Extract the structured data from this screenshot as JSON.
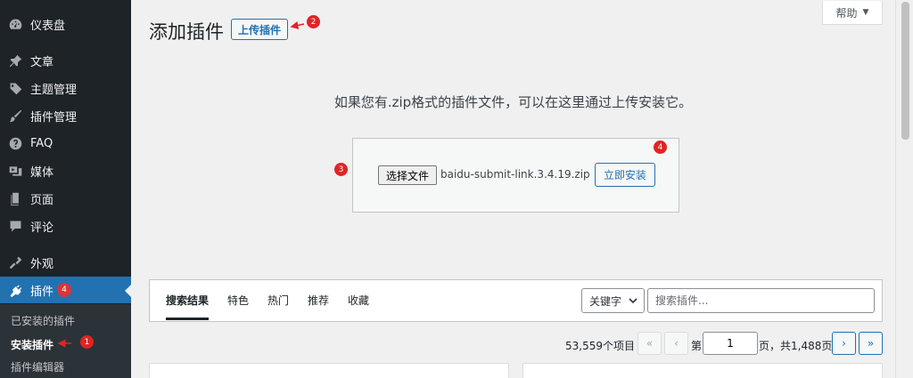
{
  "sidebar": {
    "items": [
      {
        "label": "仪表盘",
        "icon": "dashboard-icon"
      },
      {
        "label": "文章",
        "icon": "pin-icon"
      },
      {
        "label": "主题管理",
        "icon": "tag-icon"
      },
      {
        "label": "插件管理",
        "icon": "brush-icon"
      },
      {
        "label": "FAQ",
        "icon": "help-circle-icon"
      },
      {
        "label": "媒体",
        "icon": "media-icon"
      },
      {
        "label": "页面",
        "icon": "page-icon"
      },
      {
        "label": "评论",
        "icon": "comment-icon"
      },
      {
        "label": "外观",
        "icon": "appearance-icon"
      },
      {
        "label": "插件",
        "icon": "plugins-icon",
        "badge": "4"
      }
    ],
    "submenu": [
      {
        "label": "已安装的插件"
      },
      {
        "label": "安装插件"
      },
      {
        "label": "插件编辑器"
      }
    ]
  },
  "header": {
    "title": "添加插件",
    "upload_button": "上传插件",
    "help_button": "帮助"
  },
  "upload": {
    "description": "如果您有.zip格式的插件文件，可以在这里通过上传安装它。",
    "choose_button": "选择文件",
    "file_name": "baidu-submit-link.3.4.19.zip",
    "install_button": "立即安装"
  },
  "filter": {
    "tabs": [
      {
        "label": "搜索结果"
      },
      {
        "label": "特色"
      },
      {
        "label": "热门"
      },
      {
        "label": "推荐"
      },
      {
        "label": "收藏"
      }
    ],
    "keyword_select": "关键字",
    "search_placeholder": "搜索插件..."
  },
  "pagination": {
    "items_count": "53,559个项目",
    "first": "«",
    "prev": "‹",
    "page_prefix": "第",
    "current_page": "1",
    "page_suffix": "页，共1,488页",
    "next": "›",
    "last": "»"
  },
  "annotations": [
    "1",
    "2",
    "3",
    "4"
  ],
  "colors": {
    "sidebar_bg": "#1d2327",
    "accent": "#2271b1",
    "annotation": "#e02424"
  }
}
